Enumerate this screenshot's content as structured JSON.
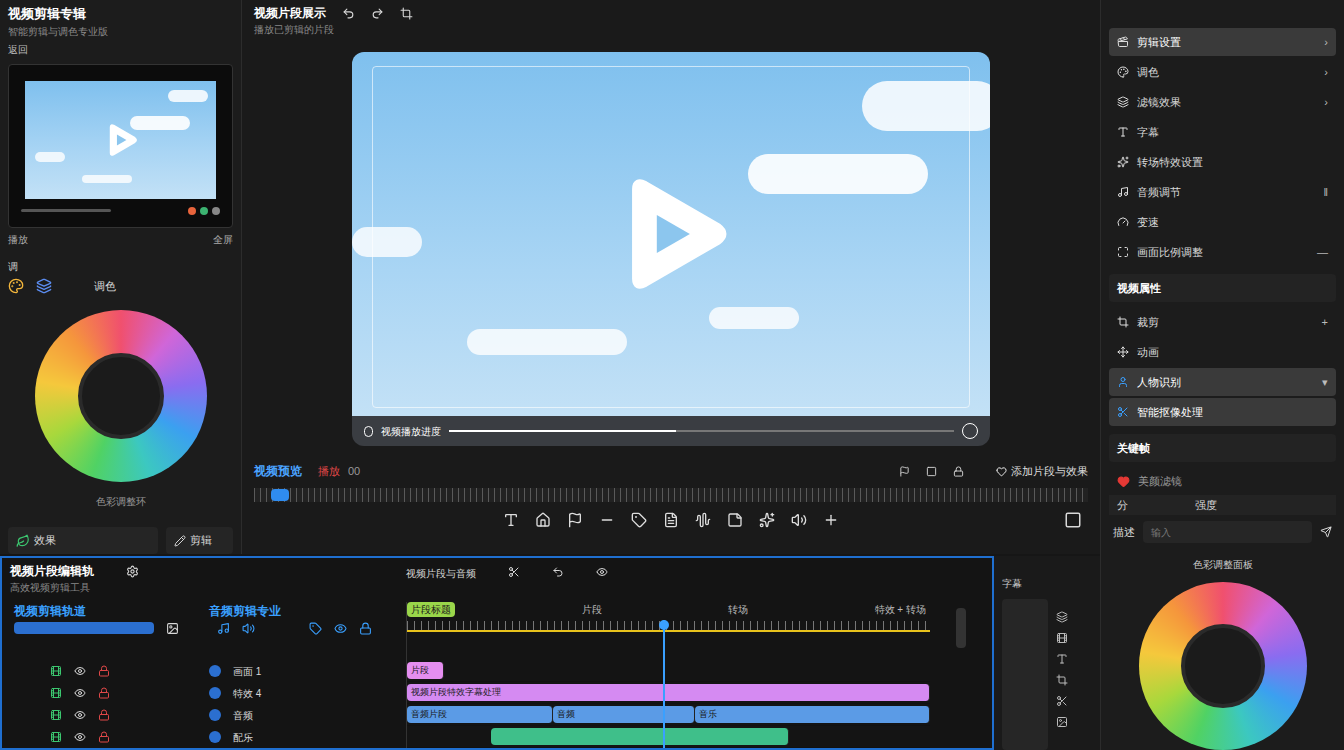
{
  "app": {
    "title": "视频剪辑专辑",
    "subtitle": "智能剪辑与调色专业版",
    "back": "返回"
  },
  "left": {
    "thumb_left": "播放",
    "thumb_right": "全屏",
    "section": "调",
    "color_title": "调色",
    "color_caption": "色彩调整环",
    "effect": "效果",
    "cut": "剪辑"
  },
  "preview": {
    "title": "视频片段展示",
    "subtitle": "播放已剪辑的片段",
    "bar_text": "视频播放进度",
    "progress": 0.45
  },
  "transport": {
    "label": "视频预览",
    "rec": "播放",
    "time": "00",
    "add": "添加片段与效果",
    "scrub": 0.02
  },
  "right": {
    "items": [
      {
        "label": "剪辑设置",
        "trail": "›",
        "kind": "item",
        "selected": true
      },
      {
        "label": "调色",
        "trail": "›",
        "kind": "item",
        "selected": false
      },
      {
        "label": "滤镜效果",
        "trail": "›",
        "kind": "item",
        "selected": false
      },
      {
        "label": "字幕",
        "trail": "",
        "kind": "item",
        "selected": false
      },
      {
        "label": "转场特效设置",
        "trail": "",
        "kind": "item",
        "selected": false
      },
      {
        "label": "音频调节",
        "trail": "‖",
        "kind": "item",
        "selected": false
      },
      {
        "label": "变速",
        "trail": "",
        "kind": "item",
        "selected": false
      },
      {
        "label": "画面比例调整",
        "trail": "—",
        "kind": "item",
        "selected": false
      },
      {
        "label": "视频属性",
        "trail": "",
        "kind": "header",
        "selected": false
      },
      {
        "label": "裁剪",
        "trail": "+",
        "kind": "item",
        "selected": false
      },
      {
        "label": "动画",
        "trail": "",
        "kind": "item",
        "selected": false
      },
      {
        "label": "人物识别",
        "trail": "▾",
        "kind": "item",
        "selected": true
      },
      {
        "label": "智能抠像处理",
        "trail": "",
        "kind": "item",
        "selected": true
      },
      {
        "label": "关键帧",
        "trail": "",
        "kind": "header",
        "selected": false
      }
    ],
    "favorite": "美颜滤镜",
    "strength_label": "分",
    "strength_value": "强度",
    "desc_label": "描述",
    "desc_placeholder": "输入",
    "color_title": "色彩调整面板"
  },
  "timeline": {
    "title": "视频片段编辑轨",
    "subtitle": "高效视频剪辑工具",
    "group_a": "视频剪辑轨道",
    "group_b": "音频剪辑专业",
    "center": "视频片段与音频",
    "ruler": [
      {
        "label": "片段标题",
        "kind": "tag"
      },
      {
        "label": "片段",
        "kind": "text"
      },
      {
        "label": "转场",
        "kind": "text"
      },
      {
        "label": "特效 + 转场",
        "kind": "text"
      }
    ],
    "playhead": 0.49,
    "tracks": [
      {
        "name": "画面 1",
        "clips": [
          {
            "label": "片段",
            "start": 0,
            "end": 7,
            "color": "#e58ef0"
          }
        ]
      },
      {
        "name": "特效 4",
        "clips": [
          {
            "label": "视频片段特效字幕处理",
            "start": 0,
            "end": 100,
            "color": "#d58af2"
          }
        ]
      },
      {
        "name": "音频",
        "clips": [
          {
            "label": "音频片段",
            "start": 0,
            "end": 28,
            "color": "#5b9be6"
          },
          {
            "label": "音频",
            "start": 28,
            "end": 55,
            "color": "#5b9be6"
          },
          {
            "label": "音乐",
            "start": 55,
            "end": 100,
            "color": "#5b9be6"
          }
        ]
      },
      {
        "name": "配乐",
        "clips": [
          {
            "label": "",
            "start": 16,
            "end": 73,
            "color": "#3fbf8a"
          }
        ]
      }
    ]
  },
  "side": {
    "label": "字幕"
  }
}
